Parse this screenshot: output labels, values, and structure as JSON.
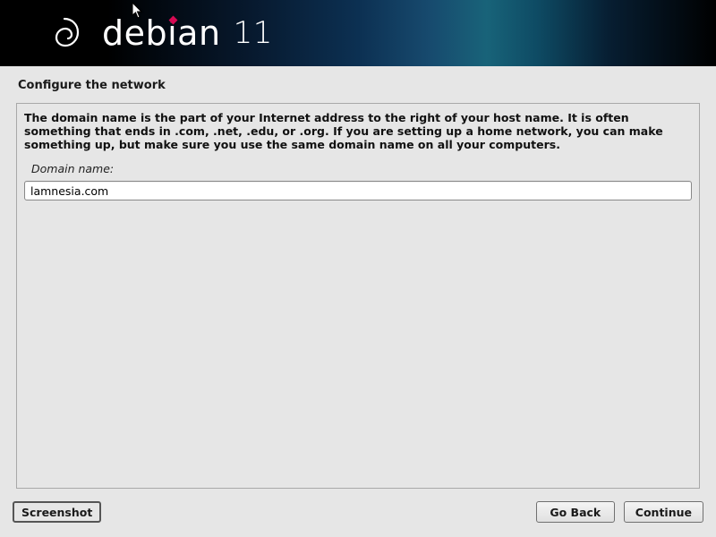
{
  "header": {
    "brand_name": "debian",
    "brand_version": "11"
  },
  "installer": {
    "section_title": "Configure the network",
    "description": "The domain name is the part of your Internet address to the right of your host name.  It is often something that ends in .com, .net, .edu, or .org.  If you are setting up a home network, you can make something up, but make sure you use the same domain name on all your computers.",
    "field_label": "Domain name:",
    "field_value": "lamnesia.com"
  },
  "buttons": {
    "screenshot": "Screenshot",
    "go_back": "Go Back",
    "continue": "Continue"
  }
}
